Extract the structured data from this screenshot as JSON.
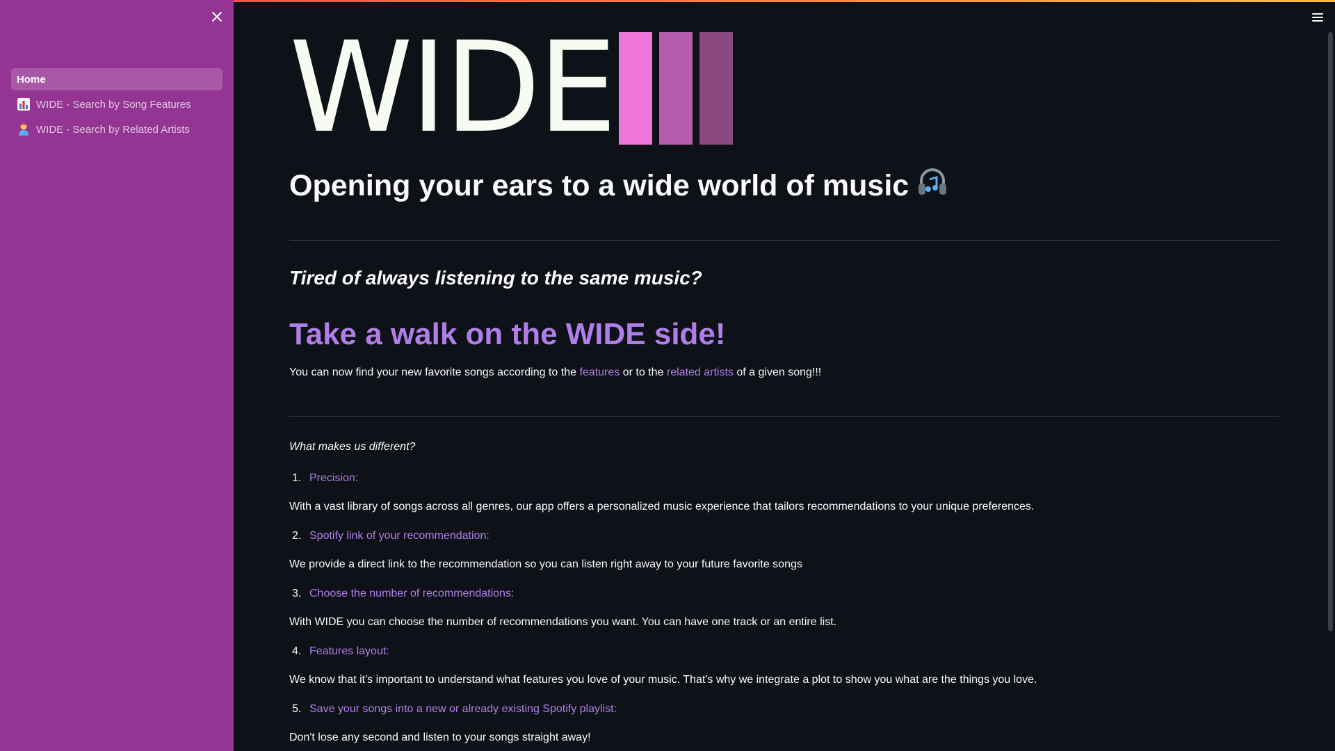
{
  "sidebar": {
    "items": [
      {
        "label": "Home",
        "icon": "home"
      },
      {
        "label": "WIDE - Search by Song Features",
        "icon": "bar-chart-icon"
      },
      {
        "label": "WIDE - Search by Related Artists",
        "icon": "artist-icon"
      }
    ]
  },
  "logo": {
    "text": "WIDE",
    "bar_colors": [
      "#ee76d9",
      "#b65cae",
      "#8a4a80"
    ]
  },
  "main": {
    "title": "Opening your ears to a wide world of music",
    "title_icon": "headphones-icon",
    "subtitle": "Tired of always listening to the same music?",
    "headline": "Take a walk on the WIDE side!",
    "intro": {
      "before": "You can now find your new favorite songs according to the",
      "link1": "features",
      "middle": "or to the",
      "link2": "related artists",
      "after": "of a given song!!!"
    },
    "question": "What makes us different?",
    "features": [
      {
        "num": "1.",
        "title": "Precision:",
        "desc": "With a vast library of songs across all genres, our app offers a personalized music experience that tailors recommendations to your unique preferences."
      },
      {
        "num": "2.",
        "title": "Spotify link of your recommendation:",
        "desc": "We provide a direct link to the recommendation so you can listen right away to your future favorite songs"
      },
      {
        "num": "3.",
        "title": "Choose the number of recommendations:",
        "desc": "With WIDE you can choose the number of recommendations you want. You can have one track or an entire list."
      },
      {
        "num": "4.",
        "title": "Features layout:",
        "desc": "We know that it's important to understand what features you love of your music. That's why we integrate a plot to show you what are the things you love."
      },
      {
        "num": "5.",
        "title": "Save your songs into a new or already existing Spotify playlist:",
        "desc": "Don't lose any second and listen to your songs straight away!"
      }
    ]
  },
  "colors": {
    "sidebar_bg": "#943594",
    "main_bg": "#0e1117",
    "accent": "#b07ee9"
  }
}
